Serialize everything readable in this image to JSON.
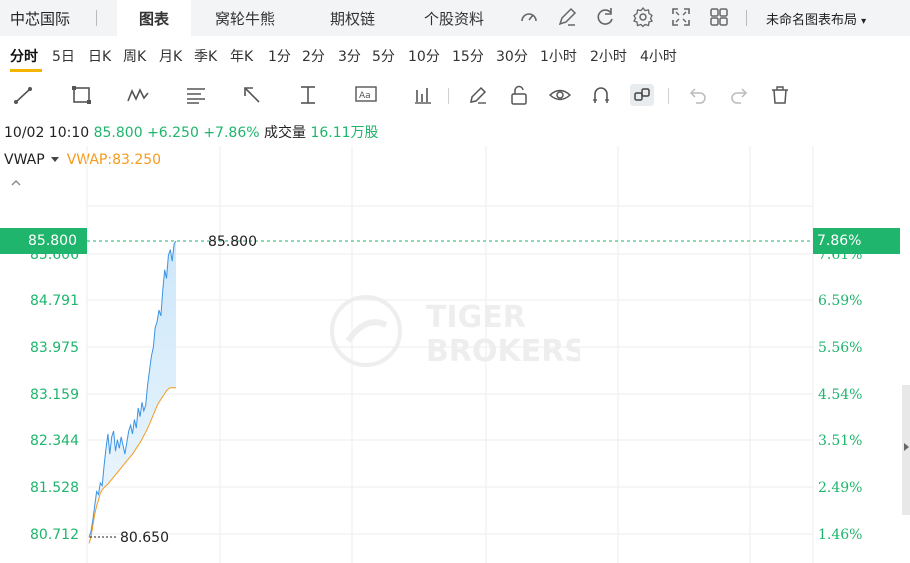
{
  "topbar": {
    "stock_name": "中芯国际",
    "tabs": [
      "图表",
      "窝轮牛熊",
      "期权链",
      "个股资料"
    ],
    "active_tab": "图表",
    "layout_label": "未命名图表布局"
  },
  "periods": [
    "分时",
    "5日",
    "日K",
    "周K",
    "月K",
    "季K",
    "年K",
    "1分",
    "2分",
    "3分",
    "5分",
    "10分",
    "15分",
    "30分",
    "1小时",
    "2小时",
    "4小时"
  ],
  "active_period": "分时",
  "tools": [
    "line-tool-icon",
    "rectangle-tool-icon",
    "pattern-tool-icon",
    "fib-tool-icon",
    "arrow-tool-icon",
    "measure-tool-icon",
    "text-tool-icon",
    "indicator-tool-icon",
    "pencil-icon",
    "unlock-icon",
    "eye-icon",
    "magnet-icon",
    "link-icon",
    "undo-icon",
    "redo-icon",
    "trash-icon"
  ],
  "info": {
    "datetime": "10/02 10:10",
    "price": "85.800",
    "change": "+6.250",
    "change_pct": "+7.86%",
    "volume_label": "成交量",
    "volume": "16.11万股"
  },
  "indicator": {
    "name": "VWAP",
    "value_label": "VWAP:83.250"
  },
  "price_tag_left": "85.800",
  "price_tag_right": "7.86%",
  "watermark": [
    "TIGER",
    "BROKERS"
  ],
  "colors": {
    "up_green": "#1fb56c",
    "price_line": "#3b93e4",
    "vwap_line": "#f59a1d",
    "active_period": "#f5b400"
  },
  "chart_data": {
    "type": "line",
    "y_left_ticks": [
      "85.606",
      "84.791",
      "83.975",
      "83.159",
      "82.344",
      "81.528",
      "80.712"
    ],
    "y_right_ticks": [
      "7.61%",
      "6.59%",
      "5.56%",
      "4.54%",
      "3.51%",
      "2.49%",
      "1.46%"
    ],
    "current_price": 85.8,
    "current_price_label": "85.800",
    "low_price": 80.65,
    "low_price_label": "80.650",
    "series": [
      {
        "values": [
          80.65,
          80.75,
          80.95,
          81.2,
          81.45,
          81.4,
          81.6,
          81.55,
          81.9,
          82.2,
          82.45,
          82.1,
          82.4,
          82.5,
          82.15,
          82.35,
          82.2,
          82.4,
          82.25,
          82.1,
          82.3,
          82.5,
          82.6,
          82.45,
          82.7,
          82.55,
          82.9,
          82.75,
          83.0,
          82.85,
          82.95,
          83.3,
          83.55,
          83.8,
          83.95,
          84.3,
          84.4,
          84.6,
          84.5,
          84.95,
          85.3,
          85.15,
          85.55,
          85.65,
          85.45,
          85.75,
          85.8
        ]
      },
      {
        "name": "VWAP",
        "values": [
          80.55,
          80.65,
          80.85,
          81.05,
          81.2,
          81.3,
          81.42,
          81.48,
          81.52,
          81.55,
          81.58,
          81.62,
          81.66,
          81.7,
          81.74,
          81.78,
          81.82,
          81.86,
          81.9,
          81.94,
          81.98,
          82.02,
          82.06,
          82.1,
          82.15,
          82.2,
          82.25,
          82.3,
          82.36,
          82.42,
          82.48,
          82.55,
          82.62,
          82.7,
          82.78,
          82.86,
          82.94,
          83.0,
          83.05,
          83.1,
          83.15,
          83.2,
          83.23,
          83.25,
          83.25,
          83.25,
          83.25
        ]
      }
    ]
  }
}
